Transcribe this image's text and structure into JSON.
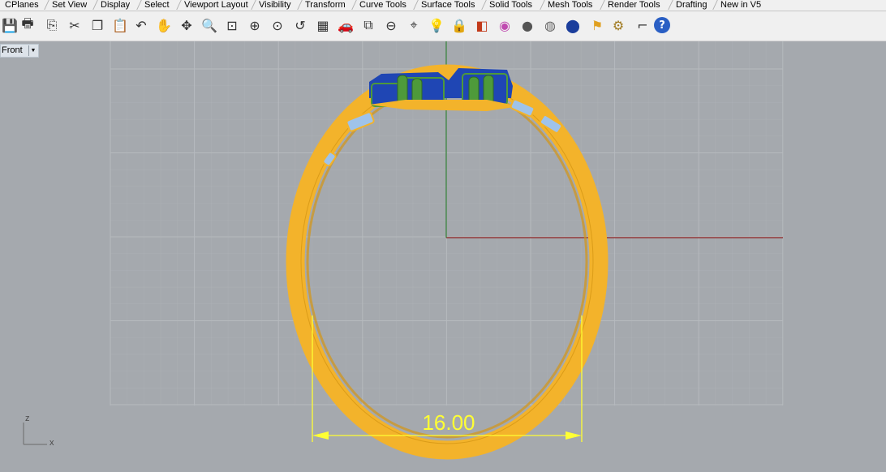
{
  "tabs": [
    {
      "label": "CPlanes"
    },
    {
      "label": "Set View"
    },
    {
      "label": "Display"
    },
    {
      "label": "Select"
    },
    {
      "label": "Viewport Layout"
    },
    {
      "label": "Visibility"
    },
    {
      "label": "Transform"
    },
    {
      "label": "Curve Tools"
    },
    {
      "label": "Surface Tools"
    },
    {
      "label": "Solid Tools"
    },
    {
      "label": "Mesh Tools"
    },
    {
      "label": "Render Tools"
    },
    {
      "label": "Drafting"
    },
    {
      "label": "New in V5"
    }
  ],
  "toolbar": {
    "icons": [
      "save-icon",
      "print-icon",
      "export-icon",
      "cut-icon",
      "copy-icon",
      "paste-icon",
      "undo-icon",
      "pan-icon",
      "rotate-view-icon",
      "zoom-dynamic-icon",
      "zoom-window-icon",
      "zoom-extents-icon",
      "zoom-selected-icon",
      "undo-view-icon",
      "four-viewports-icon",
      "car-named-views-icon",
      "cplane-icon",
      "snap-icon",
      "object-snap-icon",
      "light-icon",
      "lock-icon",
      "layer-icon",
      "color-wheel-icon",
      "shaded-icon",
      "rendered-icon",
      "render-sphere-icon",
      "options-icon",
      "gear-icon",
      "dimension-icon",
      "help-icon"
    ]
  },
  "viewport": {
    "name": "Front",
    "axis_z": "z",
    "axis_x": "x",
    "dimension_text": "16.00",
    "colors": {
      "ring": "#f3b32b",
      "ring_dark": "#d49614",
      "grid": "#b6babe",
      "x_axis": "#8b1e1e",
      "y_axis": "#2e7d32",
      "dimension": "#ffff33",
      "gem_green": "#4e9a3a",
      "gem_blue": "#1f46b4"
    }
  }
}
